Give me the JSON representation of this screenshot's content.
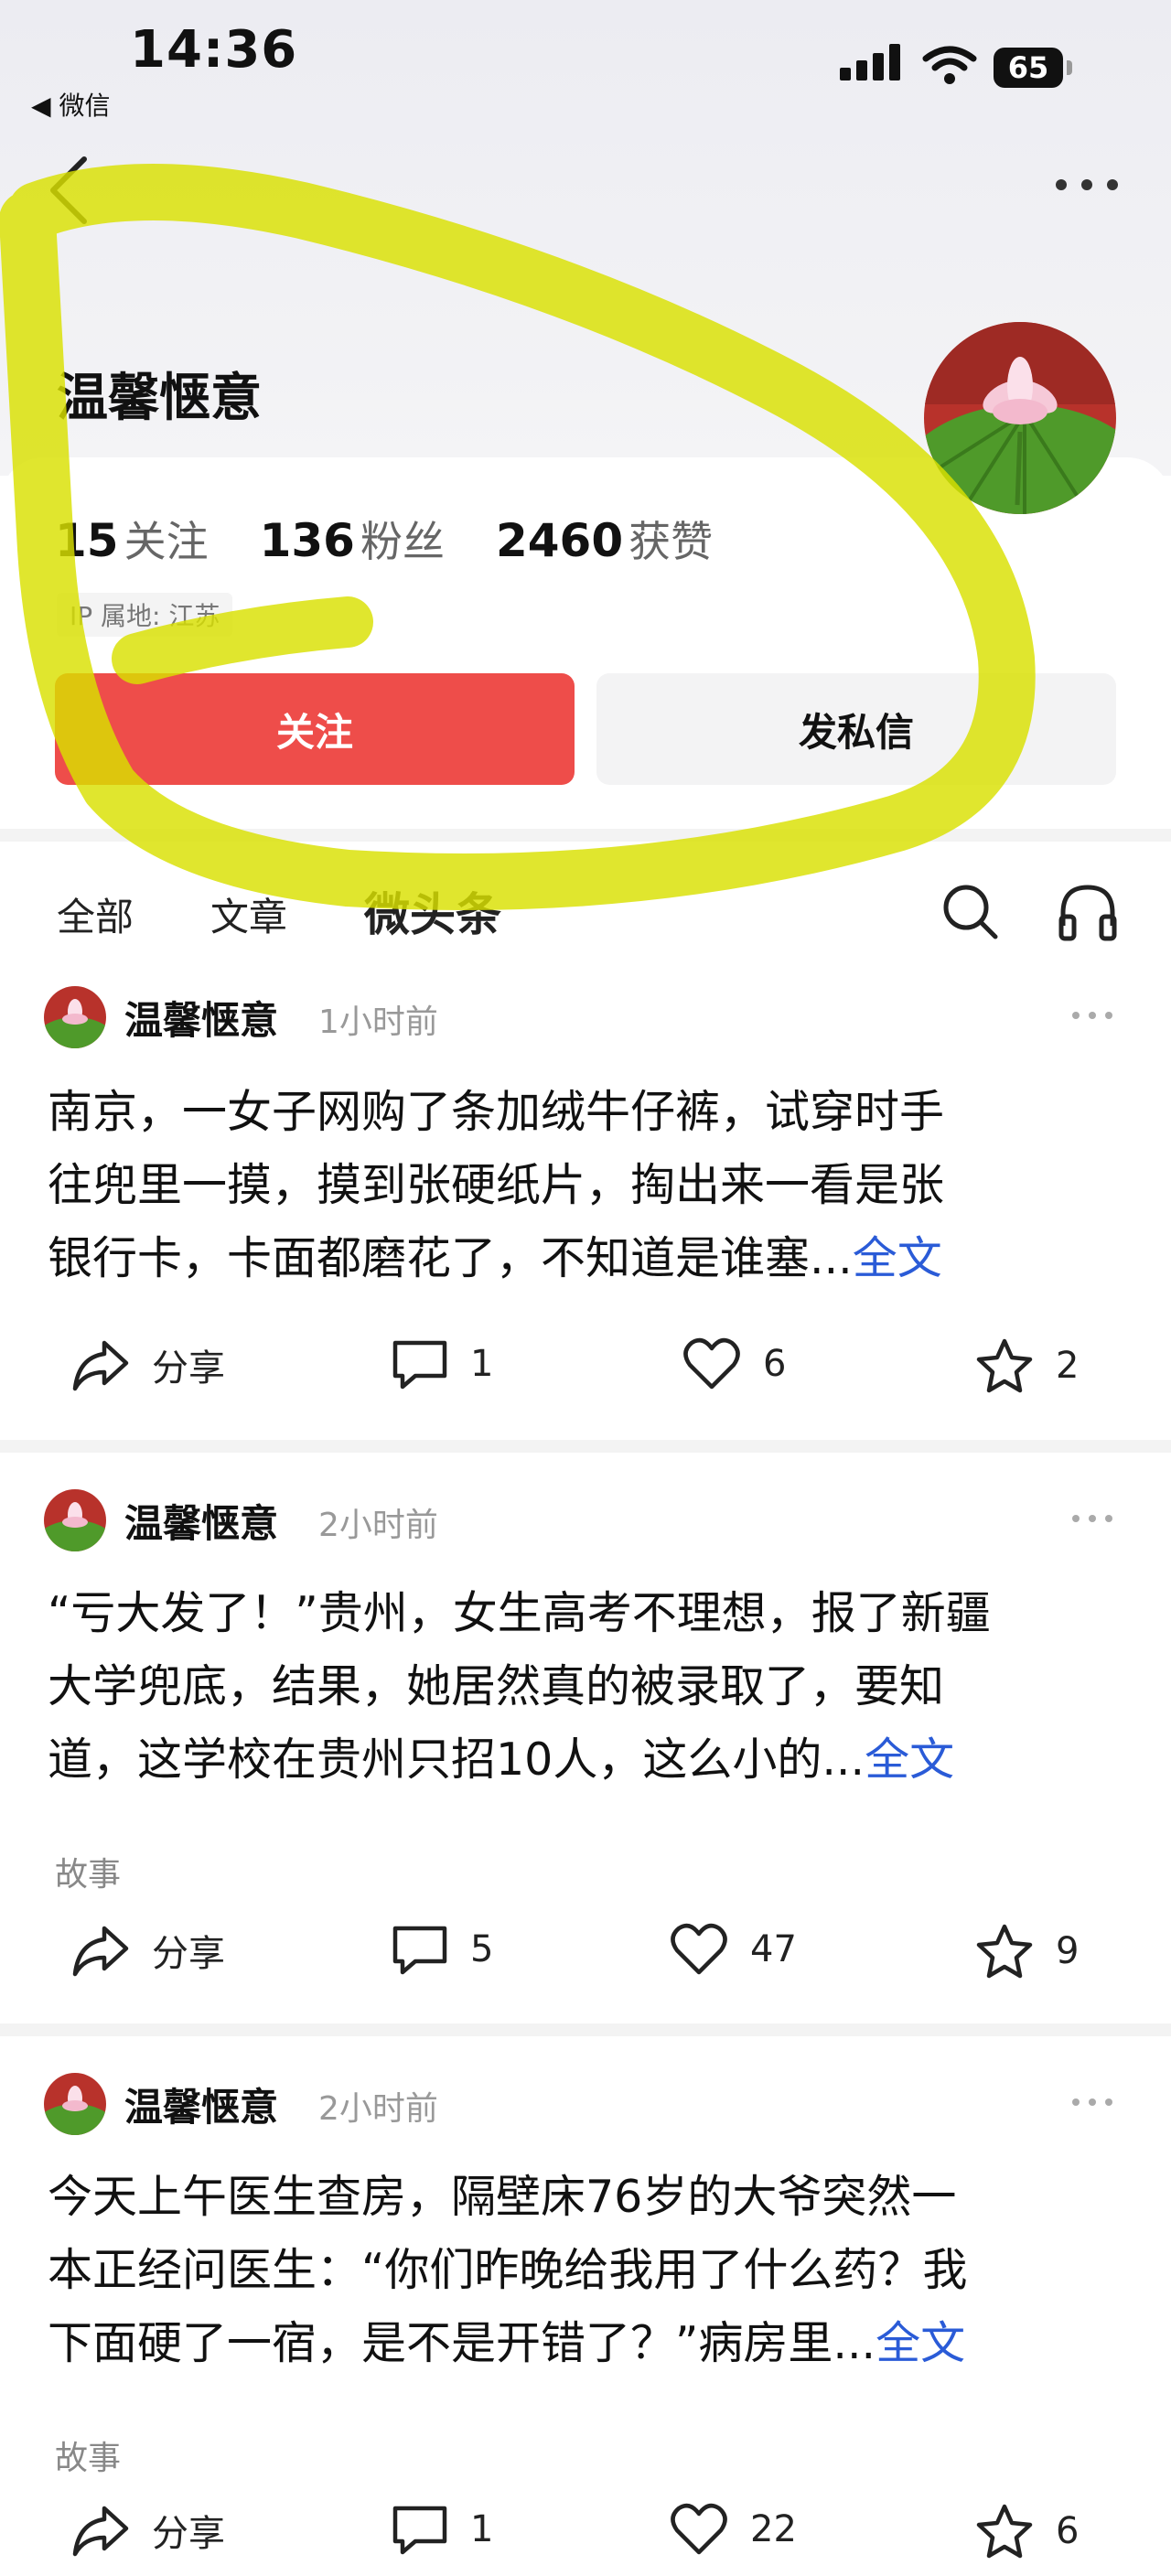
{
  "status_bar": {
    "time": "14:36",
    "back_app": "微信",
    "battery": "65"
  },
  "profile": {
    "name": "温馨惬意",
    "stats": [
      {
        "value": "15",
        "label": "关注"
      },
      {
        "value": "136",
        "label": "粉丝"
      },
      {
        "value": "2460",
        "label": "获赞"
      }
    ],
    "ip_location": "IP 属地: 江苏",
    "follow_label": "关注",
    "message_label": "发私信"
  },
  "tabs": [
    {
      "label": "全部"
    },
    {
      "label": "文章"
    },
    {
      "label": "微头条"
    }
  ],
  "posts": [
    {
      "author": "温馨惬意",
      "time": "1小时前",
      "lines": [
        "南京，一女子网购了条加绒牛仔裤，试穿时手",
        "往兜里一摸，摸到张硬纸片，掏出来一看是张",
        "银行卡，卡面都磨花了，不知道是谁塞..."
      ],
      "full_label": "全文",
      "tag": "",
      "share_label": "分享",
      "comments": "1",
      "likes": "6",
      "favorites": "2"
    },
    {
      "author": "温馨惬意",
      "time": "2小时前",
      "lines": [
        "“亏大发了！”贵州，女生高考不理想，报了新疆",
        "大学兜底，结果，她居然真的被录取了，要知",
        "道，这学校在贵州只招10人，这么小的..."
      ],
      "full_label": "全文",
      "tag": "故事",
      "share_label": "分享",
      "comments": "5",
      "likes": "47",
      "favorites": "9"
    },
    {
      "author": "温馨惬意",
      "time": "2小时前",
      "lines": [
        "今天上午医生查房，隔壁床76岁的大爷突然一",
        "本正经问医生：“你们昨晚给我用了什么药？我",
        "下面硬了一宿，是不是开错了？”病房里..."
      ],
      "full_label": "全文",
      "tag": "故事",
      "share_label": "分享",
      "comments": "1",
      "likes": "22",
      "favorites": "6"
    }
  ]
}
